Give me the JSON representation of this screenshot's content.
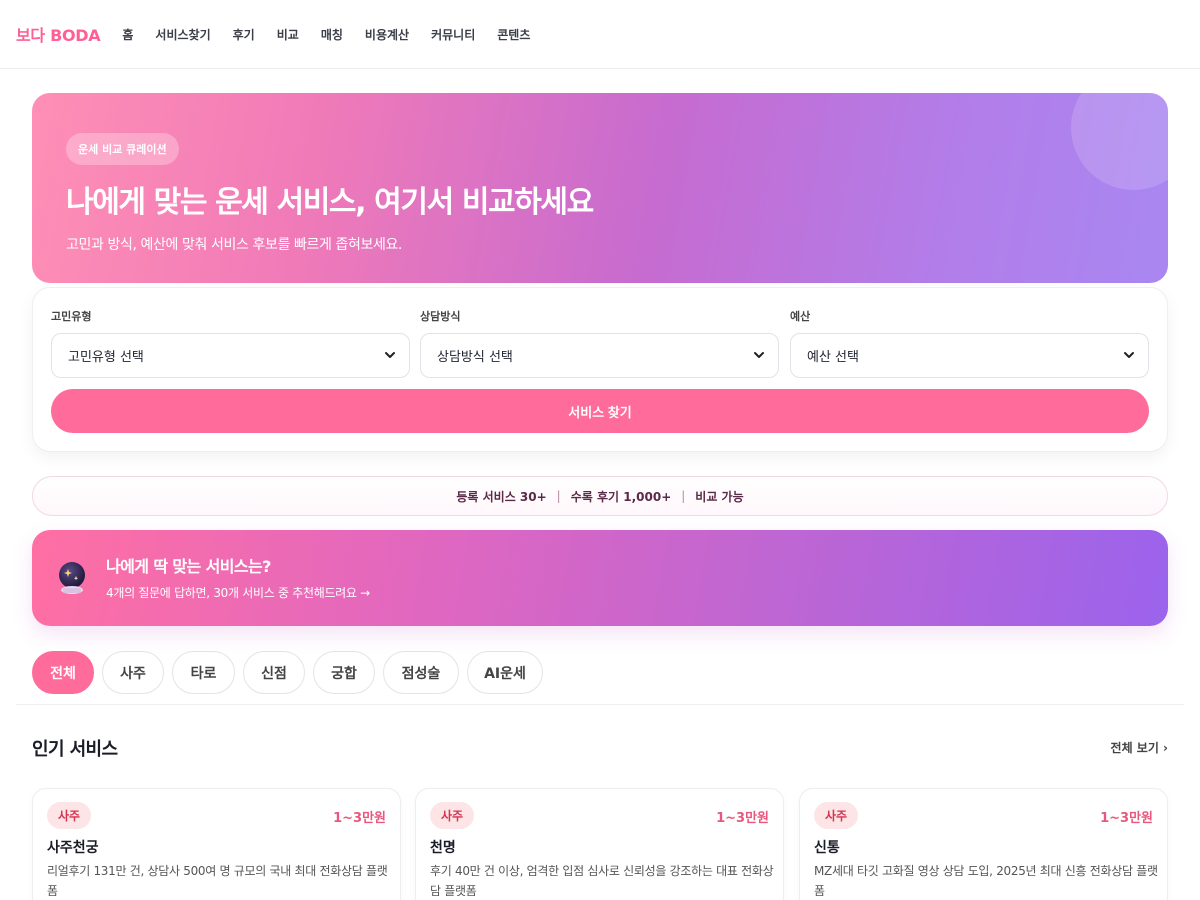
{
  "header": {
    "brand": "보다 BODA",
    "nav": [
      "홈",
      "서비스찾기",
      "후기",
      "비교",
      "매칭",
      "비용계산",
      "커뮤니티",
      "콘텐츠"
    ]
  },
  "hero": {
    "badge": "운세 비교 큐레이션",
    "title": "나에게 맞는 운세 서비스, 여기서 비교하세요",
    "subtitle": "고민과 방식, 예산에 맞춰 서비스 후보를 빠르게 좁혀보세요."
  },
  "filters": {
    "concern": {
      "label": "고민유형",
      "value": "고민유형 선택"
    },
    "method": {
      "label": "상담방식",
      "value": "상담방식 선택"
    },
    "budget": {
      "label": "예산",
      "value": "예산 선택"
    },
    "submit": "서비스 찾기"
  },
  "stats": {
    "services": "등록 서비스 30+",
    "reviews": "수록 후기 1,000+",
    "compare": "비교 가능"
  },
  "recommend": {
    "icon": "crystal-ball-icon",
    "title": "나에게 딱 맞는 서비스는?",
    "subtitle": "4개의 질문에 답하면, 30개 서비스 중 추천해드려요 →"
  },
  "tabs": {
    "items": [
      "전체",
      "사주",
      "타로",
      "신점",
      "궁합",
      "점성술",
      "AI운세"
    ],
    "active": "전체"
  },
  "popular": {
    "title": "인기 서비스",
    "view_all": "전체 보기 ›",
    "cards": [
      {
        "category": "사주",
        "price": "1~3만원",
        "name": "사주천궁",
        "description": "리얼후기 131만 건, 상담사 500여 명 규모의 국내 최대 전화상담 플랫폼"
      },
      {
        "category": "사주",
        "price": "1~3만원",
        "name": "천명",
        "description": "후기 40만 건 이상, 엄격한 입점 심사로 신뢰성을 강조하는 대표 전화상담 플랫폼"
      },
      {
        "category": "사주",
        "price": "1~3만원",
        "name": "신통",
        "description": "MZ세대 타깃 고화질 영상 상담 도입, 2025년 최대 신흥 전화상담 플랫폼"
      }
    ]
  },
  "colors": {
    "accent": "#ff6b9a",
    "brand": "#ff5f96",
    "badge_bg": "#fde4e6",
    "badge_text": "#d6334e",
    "price": "#e8587e"
  }
}
